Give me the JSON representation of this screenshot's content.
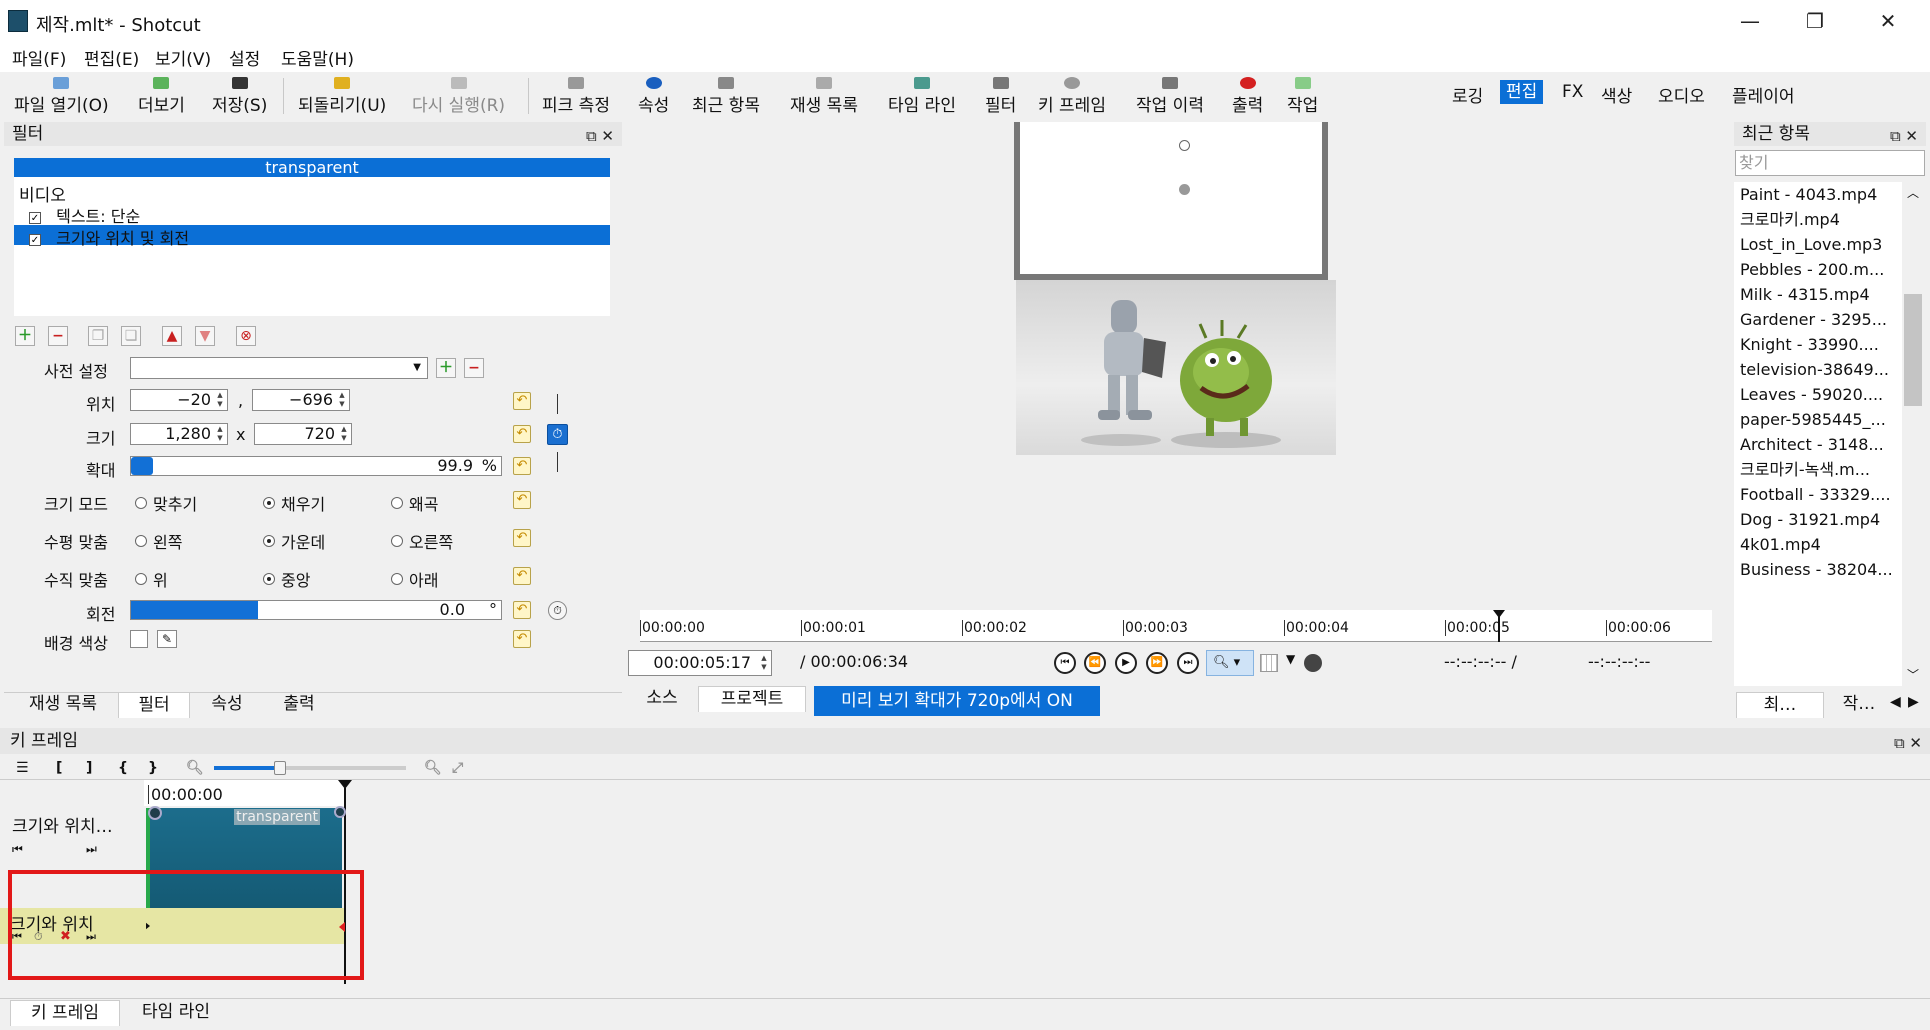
{
  "window": {
    "title": "제작.mlt* - Shotcut",
    "minimize": "—",
    "maximize": "❐",
    "close": "✕"
  },
  "menu": [
    "파일(F)",
    "편집(E)",
    "보기(V)",
    "설정",
    "도움말(H)"
  ],
  "toolbar": {
    "open": "파일 열기(O)",
    "more": "더보기",
    "save": "저장(S)",
    "undo": "되돌리기(U)",
    "redo": "다시 실행(R)",
    "peak": "피크 측정",
    "props": "속성",
    "recent": "최근 항목",
    "playlist": "재생 목록",
    "timeline": "타임 라인",
    "filters": "필터",
    "keyframes": "키 프레임",
    "history": "작업 이력",
    "export": "출력",
    "jobs": "작업"
  },
  "layouts": {
    "logging": "로깅",
    "editing": "편집",
    "fx": "FX",
    "color": "색상",
    "audio": "오디오",
    "player": "플레이어"
  },
  "filters": {
    "title": "필터",
    "clip_name": "transparent",
    "category": "비디오",
    "items": [
      {
        "label": "텍스트: 단순",
        "checked": "✓"
      },
      {
        "label": "크기와 위치 및 회전",
        "checked": "✓"
      }
    ],
    "preset_label": "사전 설정",
    "position_label": "위치",
    "pos_x": "−20",
    "pos_sep": ",",
    "pos_y": "−696",
    "size_label": "크기",
    "size_w": "1,280",
    "size_x": "x",
    "size_h": "720",
    "zoom_label": "확대",
    "zoom_value": "99.9",
    "zoom_unit": "%",
    "sizemode_label": "크기 모드",
    "sizemode_opts": [
      "맞추기",
      "채우기",
      "왜곡"
    ],
    "halign_label": "수평 맞춤",
    "halign_opts": [
      "왼쪽",
      "가운데",
      "오른쪽"
    ],
    "valign_label": "수직 맞춤",
    "valign_opts": [
      "위",
      "중앙",
      "아래"
    ],
    "rotation_label": "회전",
    "rotation_value": "0.0",
    "rotation_unit": "°",
    "bgcolor_label": "배경 색상"
  },
  "left_tabs": [
    "재생 목록",
    "필터",
    "속성",
    "출력"
  ],
  "player": {
    "ruler": [
      "00:00:00",
      "00:00:01",
      "00:00:02",
      "00:00:03",
      "00:00:04",
      "00:00:05",
      "00:00:06"
    ],
    "timecode": "00:00:05:17",
    "duration": "/ 00:00:06:34",
    "in_point": "--:--:--:-- /",
    "out_point": "--:--:--:--",
    "tab_source": "소스",
    "tab_project": "프로젝트",
    "notice": "미리 보기 확대가 720p에서 ON"
  },
  "recent": {
    "title": "최근 항목",
    "search_placeholder": "찾기",
    "items": [
      "Paint - 4043.mp4",
      "크로마키.mp4",
      "Lost_in_Love.mp3",
      "Pebbles - 200.m...",
      "Milk - 4315.mp4",
      "Gardener - 3295...",
      "Knight - 33990....",
      "television-38649...",
      "Leaves - 59020....",
      "paper-5985445_...",
      "Architect - 3148...",
      "크로마키-녹색.m...",
      "Football - 33329....",
      "Dog - 31921.mp4",
      "4k01.mp4",
      "Business - 38204..."
    ],
    "tab1": "최…",
    "tab2": "작…"
  },
  "keyframes": {
    "title": "키 프레임",
    "time": "00:00:00",
    "track1": "크기와 위치…",
    "clip_label": "transparent",
    "track2": "크기와 위치"
  },
  "bottom_tabs": [
    "키 프레임",
    "타임 라인"
  ]
}
